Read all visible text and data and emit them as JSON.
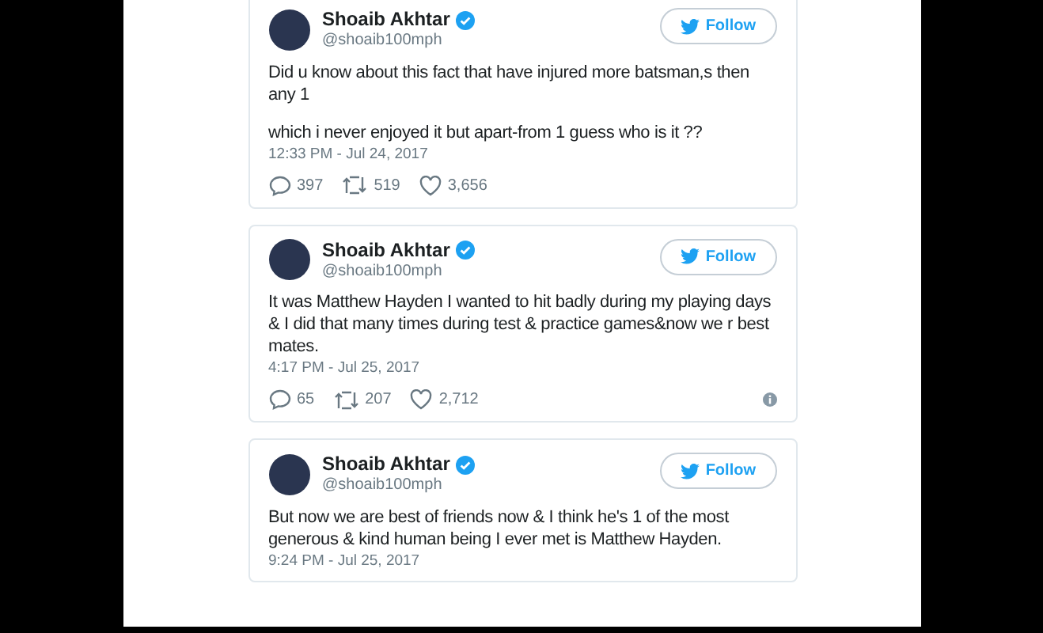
{
  "tweets": [
    {
      "name": "Shoaib Akhtar",
      "handle": "@shoaib100mph",
      "follow": "Follow",
      "paragraphs": [
        "Did u know about this fact that have injured more batsman,s then any 1",
        "which i never enjoyed it but apart-from 1 guess who is it ??"
      ],
      "time": "12:33 PM - Jul 24, 2017",
      "replies": "397",
      "retweets": "519",
      "likes": "3,656",
      "info": false
    },
    {
      "name": "Shoaib Akhtar",
      "handle": "@shoaib100mph",
      "follow": "Follow",
      "paragraphs": [
        "It was Matthew Hayden I wanted to hit badly during my playing days & I did that many times during test & practice games&now we r best mates."
      ],
      "time": "4:17 PM - Jul 25, 2017",
      "replies": "65",
      "retweets": "207",
      "likes": "2,712",
      "info": true
    },
    {
      "name": "Shoaib Akhtar",
      "handle": "@shoaib100mph",
      "follow": "Follow",
      "paragraphs": [
        "But now we are best of friends now & I think he's 1 of the most generous & kind human being I ever met is Matthew Hayden."
      ],
      "time": "9:24 PM - Jul 25, 2017"
    }
  ]
}
